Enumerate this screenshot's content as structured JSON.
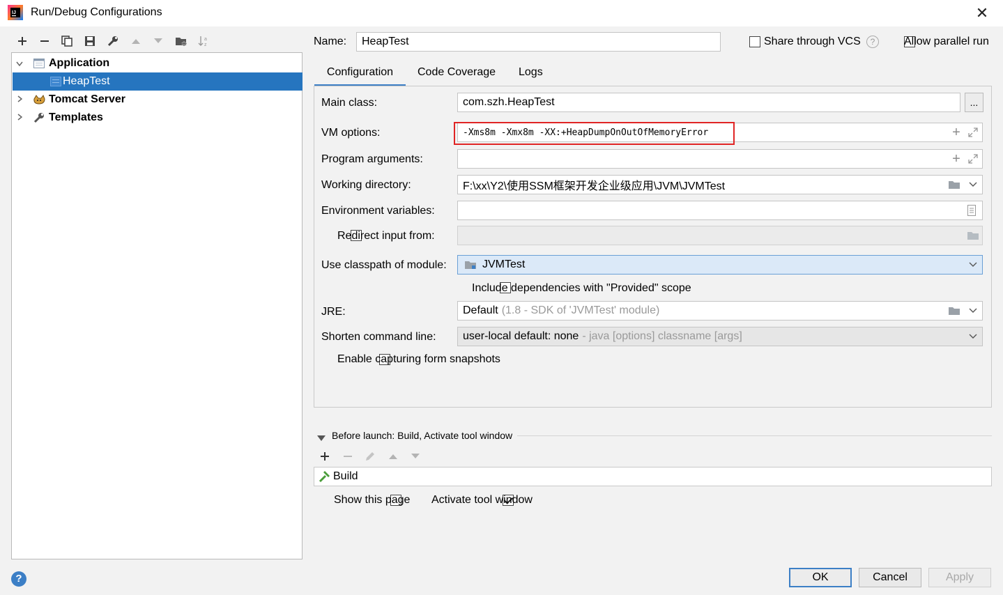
{
  "window": {
    "title": "Run/Debug Configurations",
    "app_icon": "intellij-idea-icon",
    "close_label": "✕"
  },
  "toolbar": {
    "icons": [
      "add-icon",
      "remove-icon",
      "copy-icon",
      "save-icon",
      "wrench-icon",
      "move-up-icon",
      "move-down-icon",
      "new-folder-icon",
      "sort-icon"
    ]
  },
  "tree": {
    "items": [
      {
        "label": "Application",
        "expanded": true,
        "icon": "application-icon"
      },
      {
        "label": "HeapTest",
        "selected": true,
        "icon": "run-config-icon"
      },
      {
        "label": "Tomcat Server",
        "expanded": false,
        "icon": "tomcat-icon"
      },
      {
        "label": "Templates",
        "expanded": false,
        "icon": "wrench-icon"
      }
    ]
  },
  "header": {
    "name_label": "Name:",
    "name_value": "HeapTest",
    "share_vcs_label": "Share through VCS",
    "share_vcs_checked": false,
    "help_glyph": "?",
    "allow_parallel_label": "Allow parallel run",
    "allow_parallel_checked": false
  },
  "tabs": [
    {
      "label": "Configuration",
      "active": true
    },
    {
      "label": "Code Coverage",
      "active": false
    },
    {
      "label": "Logs",
      "active": false
    }
  ],
  "form": {
    "main_class_label": "Main class:",
    "main_class_value": "com.szh.HeapTest",
    "browse_label": "...",
    "vm_options_label": "VM options:",
    "vm_options_value": "-Xms8m -Xmx8m -XX:+HeapDumpOnOutOfMemoryError",
    "program_args_label": "Program arguments:",
    "program_args_value": "",
    "working_dir_label": "Working directory:",
    "working_dir_value": "F:\\xx\\Y2\\使用SSM框架开发企业级应用\\JVM\\JVMTest",
    "env_vars_label": "Environment variables:",
    "env_vars_value": "",
    "redirect_label": "Redirect input from:",
    "redirect_checked": false,
    "classpath_label": "Use classpath of module:",
    "classpath_value": "JVMTest",
    "include_deps_label": "Include dependencies with \"Provided\" scope",
    "include_deps_checked": false,
    "jre_label": "JRE:",
    "jre_value": "Default",
    "jre_hint": "(1.8 - SDK of 'JVMTest' module)",
    "shorten_label": "Shorten command line:",
    "shorten_value": "user-local default: none",
    "shorten_hint": "- java [options] classname [args]",
    "capture_label": "Enable capturing form snapshots",
    "capture_checked": false
  },
  "before_launch": {
    "title": "Before launch: Build, Activate tool window",
    "task": "Build",
    "show_page_label": "Show this page",
    "show_page_checked": false,
    "activate_label": "Activate tool window",
    "activate_checked": true
  },
  "buttons": {
    "ok": "OK",
    "cancel": "Cancel",
    "apply": "Apply",
    "help": "?"
  },
  "colors": {
    "selection": "#2675bf",
    "highlight_box": "#e02424",
    "module_field": "#dbe9f8",
    "accent": "#3c7fc6"
  }
}
